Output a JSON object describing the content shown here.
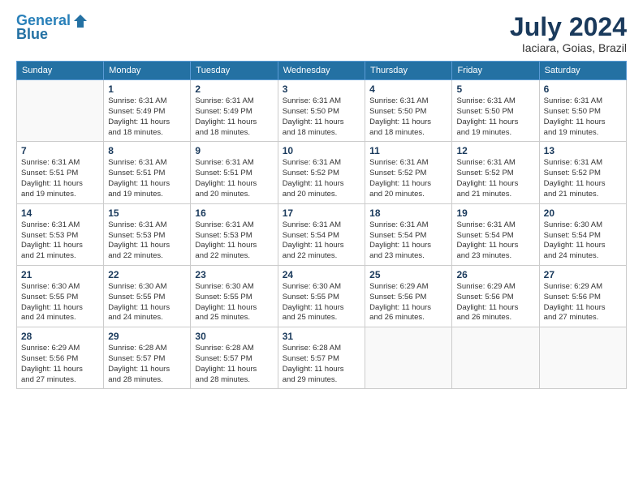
{
  "header": {
    "logo_line1": "General",
    "logo_line2": "Blue",
    "title": "July 2024",
    "location": "Iaciara, Goias, Brazil"
  },
  "weekdays": [
    "Sunday",
    "Monday",
    "Tuesday",
    "Wednesday",
    "Thursday",
    "Friday",
    "Saturday"
  ],
  "weeks": [
    [
      {
        "day": "",
        "info": ""
      },
      {
        "day": "1",
        "info": "Sunrise: 6:31 AM\nSunset: 5:49 PM\nDaylight: 11 hours\nand 18 minutes."
      },
      {
        "day": "2",
        "info": "Sunrise: 6:31 AM\nSunset: 5:49 PM\nDaylight: 11 hours\nand 18 minutes."
      },
      {
        "day": "3",
        "info": "Sunrise: 6:31 AM\nSunset: 5:50 PM\nDaylight: 11 hours\nand 18 minutes."
      },
      {
        "day": "4",
        "info": "Sunrise: 6:31 AM\nSunset: 5:50 PM\nDaylight: 11 hours\nand 18 minutes."
      },
      {
        "day": "5",
        "info": "Sunrise: 6:31 AM\nSunset: 5:50 PM\nDaylight: 11 hours\nand 19 minutes."
      },
      {
        "day": "6",
        "info": "Sunrise: 6:31 AM\nSunset: 5:50 PM\nDaylight: 11 hours\nand 19 minutes."
      }
    ],
    [
      {
        "day": "7",
        "info": "Sunrise: 6:31 AM\nSunset: 5:51 PM\nDaylight: 11 hours\nand 19 minutes."
      },
      {
        "day": "8",
        "info": "Sunrise: 6:31 AM\nSunset: 5:51 PM\nDaylight: 11 hours\nand 19 minutes."
      },
      {
        "day": "9",
        "info": "Sunrise: 6:31 AM\nSunset: 5:51 PM\nDaylight: 11 hours\nand 20 minutes."
      },
      {
        "day": "10",
        "info": "Sunrise: 6:31 AM\nSunset: 5:52 PM\nDaylight: 11 hours\nand 20 minutes."
      },
      {
        "day": "11",
        "info": "Sunrise: 6:31 AM\nSunset: 5:52 PM\nDaylight: 11 hours\nand 20 minutes."
      },
      {
        "day": "12",
        "info": "Sunrise: 6:31 AM\nSunset: 5:52 PM\nDaylight: 11 hours\nand 21 minutes."
      },
      {
        "day": "13",
        "info": "Sunrise: 6:31 AM\nSunset: 5:52 PM\nDaylight: 11 hours\nand 21 minutes."
      }
    ],
    [
      {
        "day": "14",
        "info": "Sunrise: 6:31 AM\nSunset: 5:53 PM\nDaylight: 11 hours\nand 21 minutes."
      },
      {
        "day": "15",
        "info": "Sunrise: 6:31 AM\nSunset: 5:53 PM\nDaylight: 11 hours\nand 22 minutes."
      },
      {
        "day": "16",
        "info": "Sunrise: 6:31 AM\nSunset: 5:53 PM\nDaylight: 11 hours\nand 22 minutes."
      },
      {
        "day": "17",
        "info": "Sunrise: 6:31 AM\nSunset: 5:54 PM\nDaylight: 11 hours\nand 22 minutes."
      },
      {
        "day": "18",
        "info": "Sunrise: 6:31 AM\nSunset: 5:54 PM\nDaylight: 11 hours\nand 23 minutes."
      },
      {
        "day": "19",
        "info": "Sunrise: 6:31 AM\nSunset: 5:54 PM\nDaylight: 11 hours\nand 23 minutes."
      },
      {
        "day": "20",
        "info": "Sunrise: 6:30 AM\nSunset: 5:54 PM\nDaylight: 11 hours\nand 24 minutes."
      }
    ],
    [
      {
        "day": "21",
        "info": "Sunrise: 6:30 AM\nSunset: 5:55 PM\nDaylight: 11 hours\nand 24 minutes."
      },
      {
        "day": "22",
        "info": "Sunrise: 6:30 AM\nSunset: 5:55 PM\nDaylight: 11 hours\nand 24 minutes."
      },
      {
        "day": "23",
        "info": "Sunrise: 6:30 AM\nSunset: 5:55 PM\nDaylight: 11 hours\nand 25 minutes."
      },
      {
        "day": "24",
        "info": "Sunrise: 6:30 AM\nSunset: 5:55 PM\nDaylight: 11 hours\nand 25 minutes."
      },
      {
        "day": "25",
        "info": "Sunrise: 6:29 AM\nSunset: 5:56 PM\nDaylight: 11 hours\nand 26 minutes."
      },
      {
        "day": "26",
        "info": "Sunrise: 6:29 AM\nSunset: 5:56 PM\nDaylight: 11 hours\nand 26 minutes."
      },
      {
        "day": "27",
        "info": "Sunrise: 6:29 AM\nSunset: 5:56 PM\nDaylight: 11 hours\nand 27 minutes."
      }
    ],
    [
      {
        "day": "28",
        "info": "Sunrise: 6:29 AM\nSunset: 5:56 PM\nDaylight: 11 hours\nand 27 minutes."
      },
      {
        "day": "29",
        "info": "Sunrise: 6:28 AM\nSunset: 5:57 PM\nDaylight: 11 hours\nand 28 minutes."
      },
      {
        "day": "30",
        "info": "Sunrise: 6:28 AM\nSunset: 5:57 PM\nDaylight: 11 hours\nand 28 minutes."
      },
      {
        "day": "31",
        "info": "Sunrise: 6:28 AM\nSunset: 5:57 PM\nDaylight: 11 hours\nand 29 minutes."
      },
      {
        "day": "",
        "info": ""
      },
      {
        "day": "",
        "info": ""
      },
      {
        "day": "",
        "info": ""
      }
    ]
  ]
}
